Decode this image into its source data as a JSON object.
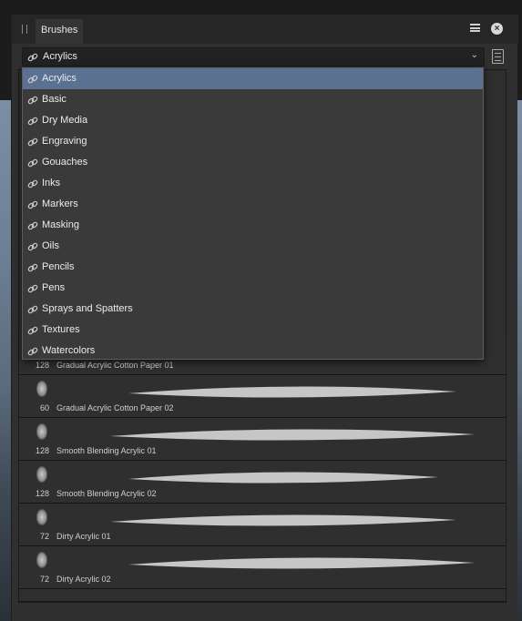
{
  "panel": {
    "tab_label": "Brushes",
    "category_selector": {
      "value": "Acrylics"
    }
  },
  "dropdown": {
    "items": [
      {
        "label": "Acrylics",
        "selected": true
      },
      {
        "label": "Basic"
      },
      {
        "label": "Dry Media"
      },
      {
        "label": "Engraving"
      },
      {
        "label": "Gouaches"
      },
      {
        "label": "Inks"
      },
      {
        "label": "Markers"
      },
      {
        "label": "Masking"
      },
      {
        "label": "Oils"
      },
      {
        "label": "Pencils"
      },
      {
        "label": "Pens"
      },
      {
        "label": "Sprays and Spatters"
      },
      {
        "label": "Textures"
      },
      {
        "label": "Watercolors"
      }
    ]
  },
  "brushes": [
    {
      "size": "128",
      "name": "Gradual Acrylic Cotton Paper 01"
    },
    {
      "size": "60",
      "name": "Gradual Acrylic Cotton Paper 02"
    },
    {
      "size": "128",
      "name": "Smooth Blending Acrylic 01"
    },
    {
      "size": "128",
      "name": "Smooth Blending Acrylic 02"
    },
    {
      "size": "72",
      "name": "Dirty Acrylic 01"
    },
    {
      "size": "72",
      "name": "Dirty Acrylic 02"
    }
  ],
  "colors": {
    "selection": "#5a7191",
    "panel_bg": "#2f2f2f"
  }
}
